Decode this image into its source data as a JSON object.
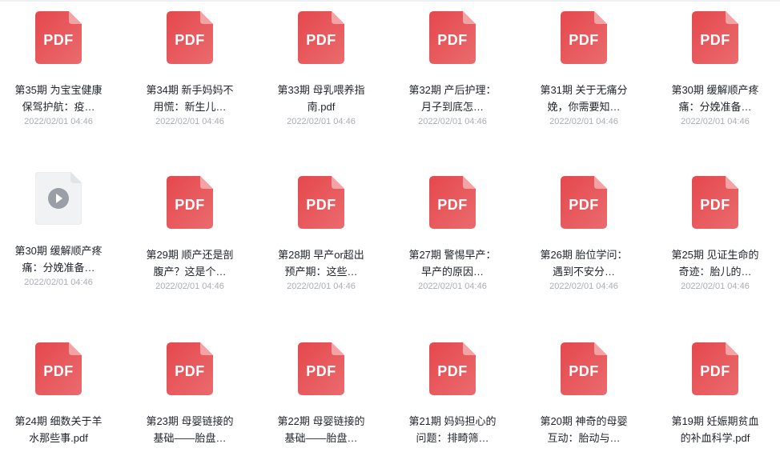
{
  "files": [
    {
      "name": "第35期 为宝宝健康保驾护航：疫…",
      "date": "2022/02/01 04:46",
      "type": "pdf",
      "icon": "pdf-icon"
    },
    {
      "name": "第34期 新手妈妈不用慌：新生儿…",
      "date": "2022/02/01 04:46",
      "type": "pdf",
      "icon": "pdf-icon"
    },
    {
      "name": "第33期 母乳喂养指南.pdf",
      "date": "2022/02/01 04:46",
      "type": "pdf",
      "icon": "pdf-icon"
    },
    {
      "name": "第32期 产后护理：月子到底怎…",
      "date": "2022/02/01 04:46",
      "type": "pdf",
      "icon": "pdf-icon"
    },
    {
      "name": "第31期 关于无痛分娩，你需要知…",
      "date": "2022/02/01 04:46",
      "type": "pdf",
      "icon": "pdf-icon"
    },
    {
      "name": "第30期 缓解顺产疼痛：分娩准备…",
      "date": "2022/02/01 04:46",
      "type": "pdf",
      "icon": "pdf-icon"
    },
    {
      "name": "第30期 缓解顺产疼痛：分娩准备…",
      "date": "2022/02/01 04:46",
      "type": "video",
      "icon": "video-play-icon"
    },
    {
      "name": "第29期 顺产还是剖腹产？这是个…",
      "date": "2022/02/01 04:46",
      "type": "pdf",
      "icon": "pdf-icon"
    },
    {
      "name": "第28期 早产or超出预产期：这些…",
      "date": "2022/02/01 04:46",
      "type": "pdf",
      "icon": "pdf-icon"
    },
    {
      "name": "第27期 警惕早产：早产的原因…",
      "date": "2022/02/01 04:46",
      "type": "pdf",
      "icon": "pdf-icon"
    },
    {
      "name": "第26期 胎位学问：遇到不安分…",
      "date": "2022/02/01 04:46",
      "type": "pdf",
      "icon": "pdf-icon"
    },
    {
      "name": "第25期 见证生命的奇迹：胎儿的…",
      "date": "2022/02/01 04:46",
      "type": "pdf",
      "icon": "pdf-icon"
    },
    {
      "name": "第24期 细数关于羊水那些事.pdf",
      "date": "",
      "type": "pdf",
      "icon": "pdf-icon"
    },
    {
      "name": "第23期 母婴链接的基础——胎盘…",
      "date": "",
      "type": "pdf",
      "icon": "pdf-icon"
    },
    {
      "name": "第22期 母婴链接的基础——胎盘…",
      "date": "",
      "type": "pdf",
      "icon": "pdf-icon"
    },
    {
      "name": "第21期 妈妈担心的问题：排畸筛…",
      "date": "",
      "type": "pdf",
      "icon": "pdf-icon"
    },
    {
      "name": "第20期 神奇的母婴互动：胎动与…",
      "date": "",
      "type": "pdf",
      "icon": "pdf-icon"
    },
    {
      "name": "第19期 妊娠期贫血的补血科学.pdf",
      "date": "",
      "type": "pdf",
      "icon": "pdf-icon"
    }
  ],
  "pdf_label": "PDF",
  "colors": {
    "pdf_red": "#e5484d",
    "pdf_red_light": "#ea6b6e",
    "fold": "#f3a3a4",
    "video_bg": "#f1f2f4",
    "play_circle": "#9a9ea6"
  }
}
